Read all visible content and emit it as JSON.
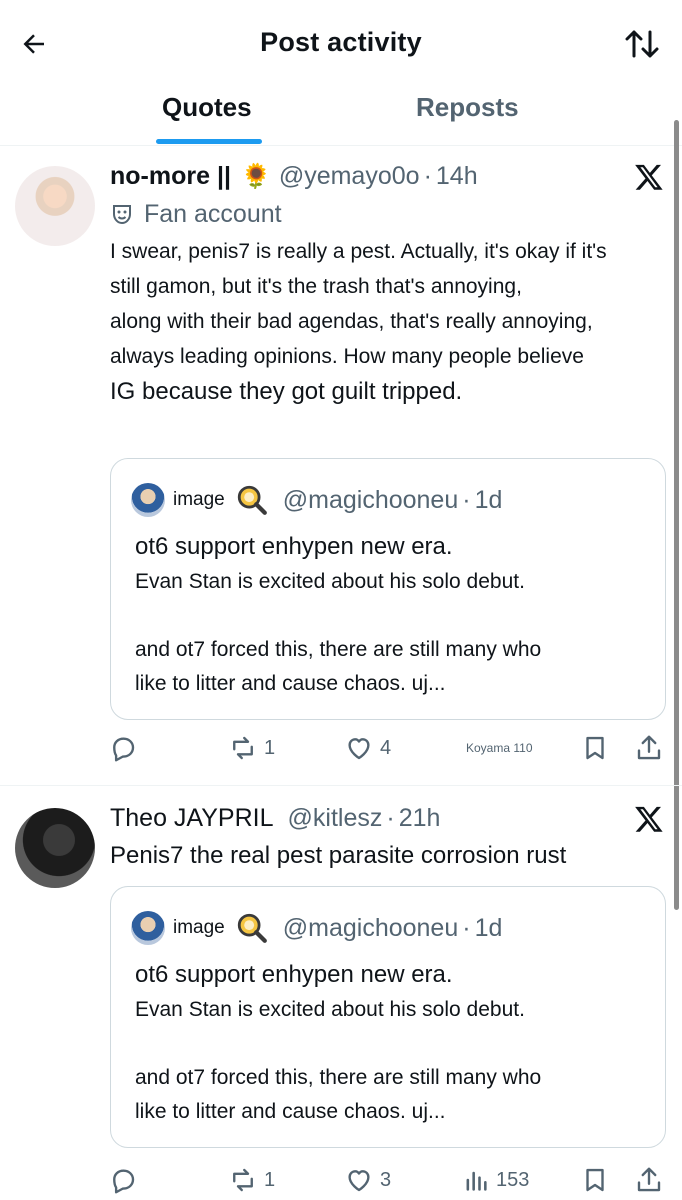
{
  "header": {
    "title": "Post activity"
  },
  "tabs": [
    {
      "label": "Quotes",
      "active": true
    },
    {
      "label": "Reposts",
      "active": false
    }
  ],
  "accent_color": "#1d9bf0",
  "posts": [
    {
      "display_name": "no-more ||",
      "emoji": "🌻",
      "handle": "@yemayo0o",
      "separator": "·",
      "time": "14h",
      "badge_label": "Fan account",
      "text_lines": [
        "I swear, penis7 is really a pest. Actually, it's okay if it's",
        "still gamon, but it's the trash that's annoying,",
        "along with their bad agendas, that's really annoying,",
        "always leading opinions. How many people believe",
        "IG because they got guilt tripped."
      ],
      "quote": {
        "image_label": "image",
        "handle": "@magichooneu",
        "separator": "·",
        "time": "1d",
        "line1": "ot6 support enhypen new era.",
        "line2": "Evan Stan is excited about his solo debut.",
        "line3": "and ot7 forced this, there are still many who",
        "line4": "like to litter and cause chaos. uj..."
      },
      "actions": {
        "reposts": "1",
        "likes": "4",
        "views_text": "Koyama 110"
      }
    },
    {
      "display_name": "Theo JAYPRIL",
      "handle": "@kitlesz",
      "separator": "·",
      "time": "21h",
      "text_lines": [
        "Penis7 the real pest parasite corrosion rust"
      ],
      "quote": {
        "image_label": "image",
        "handle": "@magichooneu",
        "separator": "·",
        "time": "1d",
        "line1": "ot6 support enhypen new era.",
        "line2": "Evan Stan is excited about his solo debut.",
        "line3": "and ot7 forced this, there are still many who",
        "line4": "like to litter and cause chaos. uj..."
      },
      "actions": {
        "reposts": "1",
        "likes": "3",
        "views": "153"
      }
    }
  ]
}
